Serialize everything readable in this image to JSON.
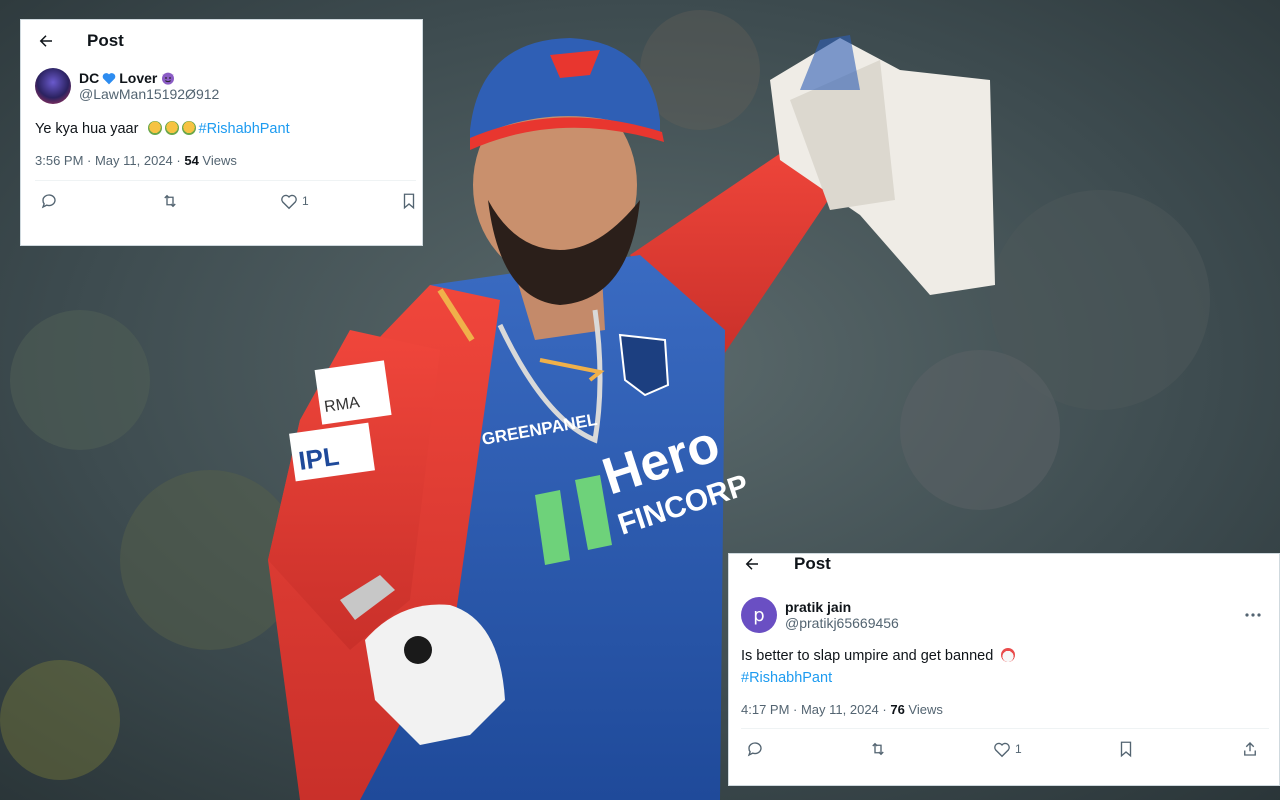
{
  "colors": {
    "hashtag": "#1d9bf0",
    "jersey_red": "#e8362f",
    "jersey_blue": "#2f5fb5",
    "card_bg": "#ffffff"
  },
  "tweet1": {
    "header_title": "Post",
    "display_name": "DC",
    "display_name_suffix": "Lover",
    "handle": "@LawMan15192Ø912",
    "text": "Ye kya hua yaar",
    "hashtag": "#RishabhPant",
    "time": "3:56 PM · May 11, 2024 · ",
    "views_count": "54",
    "views_label": " Views",
    "like_count": "1",
    "icons": [
      "back-arrow",
      "blue-heart",
      "smiling-imp",
      "reply",
      "retweet",
      "like",
      "bookmark"
    ]
  },
  "tweet2": {
    "header_title": "Post",
    "avatar_letter": "p",
    "display_name": "pratik jain",
    "handle": "@pratikj65669456",
    "text": "Is better  to slap umpire and get banned",
    "hashtag": "#RishabhPant",
    "time": "4:17 PM · May 11, 2024 · ",
    "views_count": "76",
    "views_label": " Views",
    "like_count": "1",
    "icons": [
      "back-arrow",
      "more",
      "reply",
      "retweet",
      "like",
      "bookmark",
      "share"
    ]
  },
  "photo": {
    "jersey_sponsor_1": "Hero",
    "jersey_sponsor_2": "FINCORP",
    "chest_logo": "GREENPANEL",
    "sleeve_logo": "IPL",
    "sleeve_top": "RMA"
  }
}
